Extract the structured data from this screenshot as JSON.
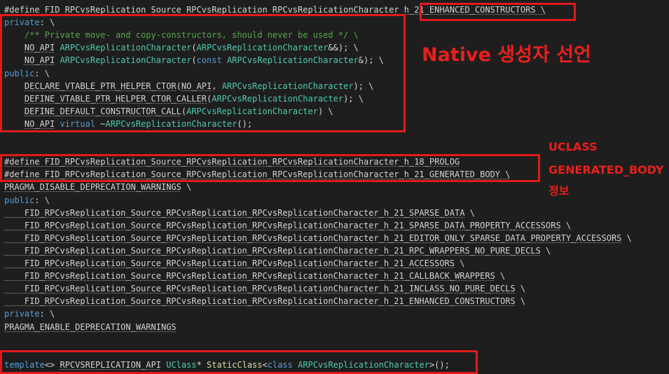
{
  "code_lines": [
    [
      {
        "t": "#define FID_RPCvsReplication_Source_RPCvsReplication_RPCvsReplicationCharacter_h_21_ENHANCED_CONSTRUCTORS \\",
        "c": "tok-macro",
        "d": true
      }
    ],
    [
      {
        "t": "private",
        "c": "tok-kw"
      },
      {
        "t": ": \\",
        "c": "tok-text"
      }
    ],
    [
      {
        "t": "    /** Private move- and copy-constructors, should never be used */ \\",
        "c": "tok-comment"
      }
    ],
    [
      {
        "t": "    ",
        "c": "tok-text"
      },
      {
        "t": "NO_API",
        "c": "tok-macro",
        "d": true
      },
      {
        "t": " ",
        "c": "tok-text"
      },
      {
        "t": "ARPCvsReplicationCharacter",
        "c": "tok-type"
      },
      {
        "t": "(",
        "c": "tok-text"
      },
      {
        "t": "ARPCvsReplicationCharacter",
        "c": "tok-type"
      },
      {
        "t": "&&); \\",
        "c": "tok-text"
      }
    ],
    [
      {
        "t": "    ",
        "c": "tok-text"
      },
      {
        "t": "NO_API",
        "c": "tok-macro",
        "d": true
      },
      {
        "t": " ",
        "c": "tok-text"
      },
      {
        "t": "ARPCvsReplicationCharacter",
        "c": "tok-type"
      },
      {
        "t": "(",
        "c": "tok-text"
      },
      {
        "t": "const",
        "c": "tok-kw"
      },
      {
        "t": " ",
        "c": "tok-text"
      },
      {
        "t": "ARPCvsReplicationCharacter",
        "c": "tok-type"
      },
      {
        "t": "&); \\",
        "c": "tok-text"
      }
    ],
    [
      {
        "t": "public",
        "c": "tok-kw"
      },
      {
        "t": ": \\",
        "c": "tok-text"
      }
    ],
    [
      {
        "t": "    ",
        "c": "tok-text"
      },
      {
        "t": "DECLARE_VTABLE_PTR_HELPER_CTOR",
        "c": "tok-macro",
        "d": true
      },
      {
        "t": "(",
        "c": "tok-text"
      },
      {
        "t": "NO_API",
        "c": "tok-macro",
        "d": true
      },
      {
        "t": ", ",
        "c": "tok-text"
      },
      {
        "t": "ARPCvsReplicationCharacter",
        "c": "tok-type"
      },
      {
        "t": "); \\",
        "c": "tok-text"
      }
    ],
    [
      {
        "t": "    ",
        "c": "tok-text"
      },
      {
        "t": "DEFINE_VTABLE_PTR_HELPER_CTOR_CALLER",
        "c": "tok-macro",
        "d": true
      },
      {
        "t": "(",
        "c": "tok-text"
      },
      {
        "t": "ARPCvsReplicationCharacter",
        "c": "tok-type"
      },
      {
        "t": "); \\",
        "c": "tok-text"
      }
    ],
    [
      {
        "t": "    ",
        "c": "tok-text"
      },
      {
        "t": "DEFINE_DEFAULT_CONSTRUCTOR_CALL",
        "c": "tok-macro",
        "d": true
      },
      {
        "t": "(",
        "c": "tok-text"
      },
      {
        "t": "ARPCvsReplicationCharacter",
        "c": "tok-type"
      },
      {
        "t": ") \\",
        "c": "tok-text"
      }
    ],
    [
      {
        "t": "    ",
        "c": "tok-text"
      },
      {
        "t": "NO_API",
        "c": "tok-macro",
        "d": true
      },
      {
        "t": " ",
        "c": "tok-text"
      },
      {
        "t": "virtual",
        "c": "tok-kw"
      },
      {
        "t": " ~",
        "c": "tok-text"
      },
      {
        "t": "ARPCvsReplicationCharacter",
        "c": "tok-type"
      },
      {
        "t": "();",
        "c": "tok-text"
      }
    ],
    [
      {
        "t": "",
        "c": "tok-text"
      }
    ],
    [
      {
        "t": "",
        "c": "tok-text"
      }
    ],
    [
      {
        "t": "#define FID_RPCvsReplication_Source_RPCvsReplication_RPCvsReplicationCharacter_h_18_PROLOG",
        "c": "tok-macro",
        "d": true
      }
    ],
    [
      {
        "t": "#define FID_RPCvsReplication_Source_RPCvsReplication_RPCvsReplicationCharacter_h_21_GENERATED_BODY \\",
        "c": "tok-macro",
        "d": true
      }
    ],
    [
      {
        "t": "PRAGMA_DISABLE_DEPRECATION_WARNINGS",
        "c": "tok-macro",
        "d": true
      },
      {
        "t": " \\",
        "c": "tok-text"
      }
    ],
    [
      {
        "t": "public",
        "c": "tok-kw"
      },
      {
        "t": ": \\",
        "c": "tok-text"
      }
    ],
    [
      {
        "t": "    FID_RPCvsReplication_Source_RPCvsReplication_RPCvsReplicationCharacter_h_21_SPARSE_DATA",
        "c": "tok-macro",
        "d": true
      },
      {
        "t": " \\",
        "c": "tok-text"
      }
    ],
    [
      {
        "t": "    FID_RPCvsReplication_Source_RPCvsReplication_RPCvsReplicationCharacter_h_21_SPARSE_DATA_PROPERTY_ACCESSORS",
        "c": "tok-macro",
        "d": true
      },
      {
        "t": " \\",
        "c": "tok-text"
      }
    ],
    [
      {
        "t": "    FID_RPCvsReplication_Source_RPCvsReplication_RPCvsReplicationCharacter_h_21_EDITOR_ONLY_SPARSE_DATA_PROPERTY_ACCESSORS",
        "c": "tok-macro",
        "d": true
      },
      {
        "t": " \\",
        "c": "tok-text"
      }
    ],
    [
      {
        "t": "    FID_RPCvsReplication_Source_RPCvsReplication_RPCvsReplicationCharacter_h_21_RPC_WRAPPERS_NO_PURE_DECLS",
        "c": "tok-macro",
        "d": true
      },
      {
        "t": " \\",
        "c": "tok-text"
      }
    ],
    [
      {
        "t": "    FID_RPCvsReplication_Source_RPCvsReplication_RPCvsReplicationCharacter_h_21_ACCESSORS",
        "c": "tok-macro",
        "d": true
      },
      {
        "t": " \\",
        "c": "tok-text"
      }
    ],
    [
      {
        "t": "    FID_RPCvsReplication_Source_RPCvsReplication_RPCvsReplicationCharacter_h_21_CALLBACK_WRAPPERS",
        "c": "tok-macro",
        "d": true
      },
      {
        "t": " \\",
        "c": "tok-text"
      }
    ],
    [
      {
        "t": "    FID_RPCvsReplication_Source_RPCvsReplication_RPCvsReplicationCharacter_h_21_INCLASS_NO_PURE_DECLS",
        "c": "tok-macro",
        "d": true
      },
      {
        "t": " \\",
        "c": "tok-text"
      }
    ],
    [
      {
        "t": "    FID_RPCvsReplication_Source_RPCvsReplication_RPCvsReplicationCharacter_h_21_ENHANCED_CONSTRUCTORS",
        "c": "tok-macro",
        "d": true
      },
      {
        "t": " \\",
        "c": "tok-text"
      }
    ],
    [
      {
        "t": "private",
        "c": "tok-kw"
      },
      {
        "t": ": \\",
        "c": "tok-text"
      }
    ],
    [
      {
        "t": "PRAGMA_ENABLE_DEPRECATION_WARNINGS",
        "c": "tok-macro",
        "d": true
      }
    ],
    [
      {
        "t": "",
        "c": "tok-text"
      }
    ],
    [
      {
        "t": "",
        "c": "tok-text"
      }
    ],
    [
      {
        "t": "template",
        "c": "tok-kw"
      },
      {
        "t": "<> ",
        "c": "tok-text"
      },
      {
        "t": "RPCVSREPLICATION_API",
        "c": "tok-macro",
        "d": true
      },
      {
        "t": " ",
        "c": "tok-text"
      },
      {
        "t": "UClass",
        "c": "tok-type"
      },
      {
        "t": "* ",
        "c": "tok-text"
      },
      {
        "t": "StaticClass",
        "c": "tok-fn"
      },
      {
        "t": "<",
        "c": "tok-text"
      },
      {
        "t": "class",
        "c": "tok-kw"
      },
      {
        "t": " ",
        "c": "tok-text"
      },
      {
        "t": "ARPCvsReplicationCharacter",
        "c": "tok-type"
      },
      {
        "t": ">();",
        "c": "tok-text"
      }
    ]
  ],
  "annotations": {
    "native_label": "Native 생성자 선언",
    "uclass_line1": "UCLASS",
    "uclass_line2": "GENERATED_BODY",
    "uclass_line3": "정보"
  },
  "colors": {
    "background": "#1e1e1e",
    "keyword": "#569cd6",
    "type": "#4ec9b0",
    "function": "#dcdcaa",
    "comment": "#57a64a",
    "text": "#d4d4d4",
    "highlight_box": "#e01b1b",
    "annotation": "#e8201c"
  }
}
